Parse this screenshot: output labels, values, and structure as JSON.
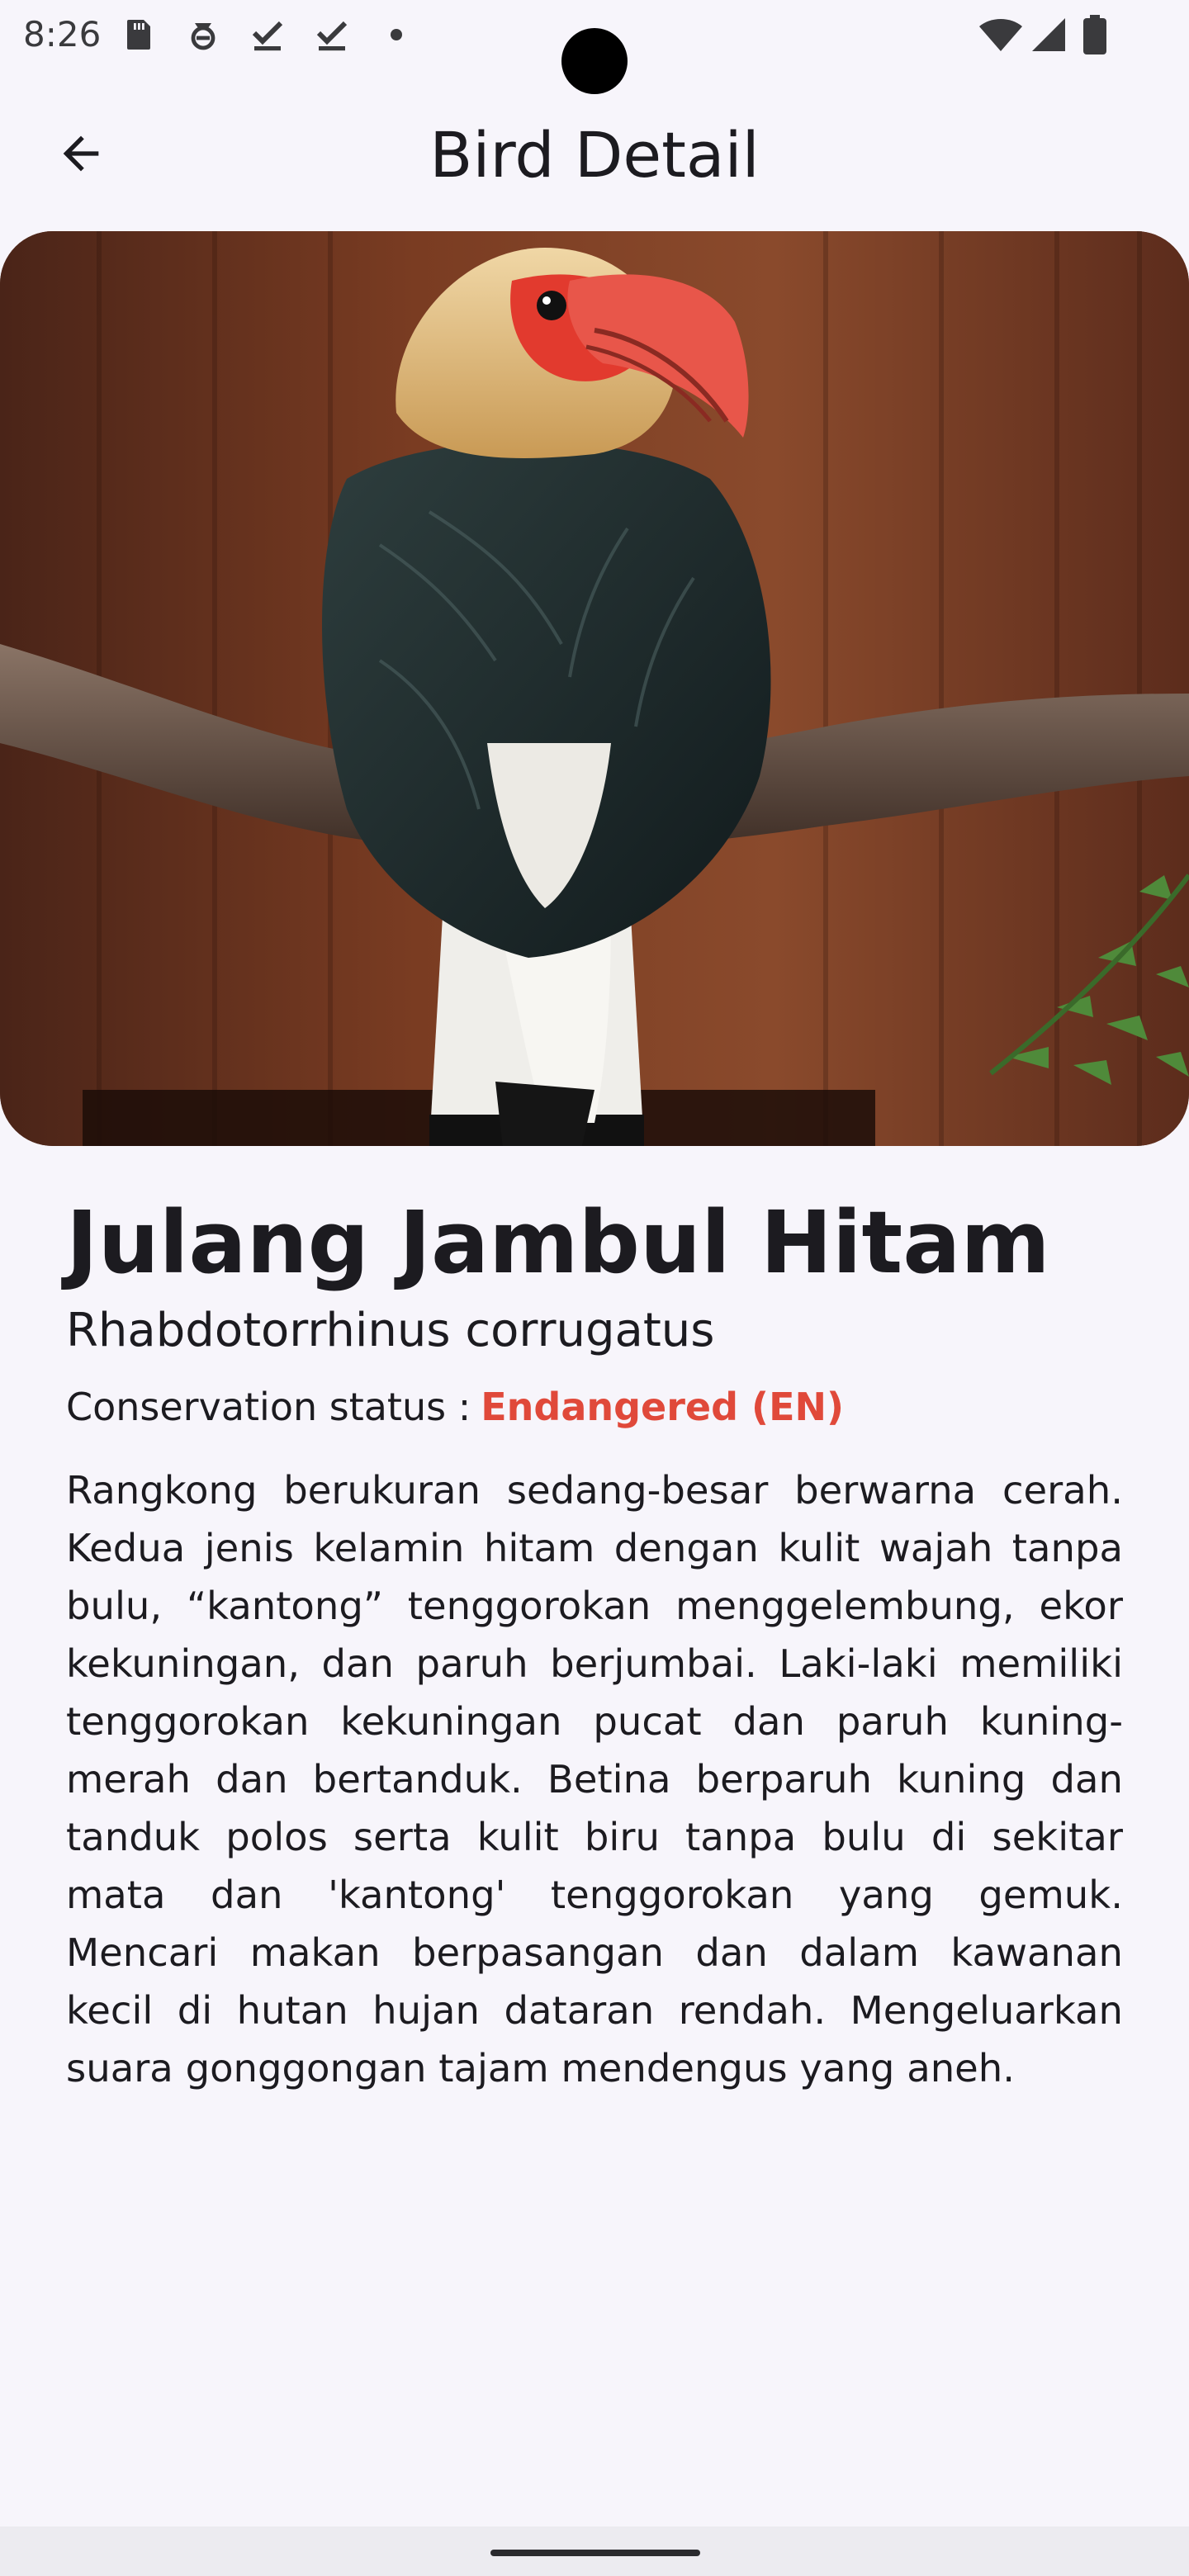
{
  "status_bar": {
    "time": "8:26",
    "left_icons": [
      "sd-card-icon",
      "assistant-icon",
      "download-done-icon",
      "download-done-icon",
      "dot-icon"
    ],
    "right_icons": [
      "wifi-icon",
      "cellular-signal-icon",
      "battery-icon"
    ]
  },
  "app_bar": {
    "title": "Bird Detail",
    "back_icon": "arrow-back-icon"
  },
  "bird": {
    "image_alt": "Julang Jambul Hitam perched on a branch",
    "name": "Julang Jambul Hitam",
    "scientific_name": "Rhabdotorrhinus corrugatus",
    "conservation_label": "Conservation status :",
    "conservation_status": "Endangered (EN)",
    "description": "Rangkong berukuran sedang-besar berwarna cerah. Kedua jenis kelamin hitam dengan kulit wajah tanpa bulu, “kantong” tenggorokan menggelembung, ekor kekuningan, dan paruh berjumbai. Laki-laki memiliki tenggorokan kekuningan pucat dan paruh kuning-merah dan bertanduk. Betina berparuh kuning dan tanduk polos serta kulit biru tanpa bulu di sekitar mata dan 'kantong' tenggorokan yang gemuk. Mencari makan berpasangan dan dalam kawanan kecil di hutan hujan dataran rendah. Mengeluarkan suara gonggongan tajam mendengus yang aneh."
  },
  "colors": {
    "background": "#f7f5fb",
    "status_accent": "#e0493a",
    "text": "#1c1b20"
  }
}
